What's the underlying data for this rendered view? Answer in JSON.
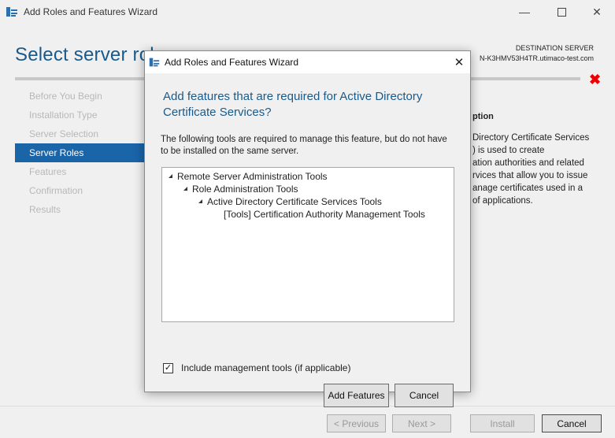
{
  "window": {
    "title": "Add Roles and Features Wizard",
    "minimize_icon": "minimize-icon",
    "maximize_icon": "maximize-icon",
    "close_icon": "close-icon"
  },
  "header": {
    "page_title": "Select server role",
    "destination_label": "DESTINATION SERVER",
    "destination_server": "N-K3HMV53H4TR.utimaco-test.com",
    "error_icon": "red-x-icon"
  },
  "nav": {
    "items": [
      {
        "label": "Before You Begin",
        "active": false
      },
      {
        "label": "Installation Type",
        "active": false
      },
      {
        "label": "Server Selection",
        "active": false
      },
      {
        "label": "Server Roles",
        "active": true
      },
      {
        "label": "Features",
        "active": false
      },
      {
        "label": "Confirmation",
        "active": false
      },
      {
        "label": "Results",
        "active": false
      }
    ]
  },
  "description": {
    "heading": "ption",
    "lines": [
      "Directory Certificate Services",
      ") is used to create",
      "ation authorities and related",
      "rvices that allow you to issue",
      "anage certificates used in a",
      " of applications."
    ]
  },
  "footer": {
    "previous_label": "< Previous",
    "next_label": "Next >",
    "install_label": "Install",
    "cancel_label": "Cancel"
  },
  "dialog": {
    "title": "Add Roles and Features Wizard",
    "heading": "Add features that are required for Active Directory Certificate Services?",
    "info": "The following tools are required to manage this feature, but do not have to be installed on the same server.",
    "tree": [
      {
        "label": "Remote Server Administration Tools",
        "level": 0,
        "expanded": true
      },
      {
        "label": "Role Administration Tools",
        "level": 1,
        "expanded": true
      },
      {
        "label": "Active Directory Certificate Services Tools",
        "level": 2,
        "expanded": true
      },
      {
        "label": "[Tools] Certification Authority Management Tools",
        "level": 3,
        "expanded": false
      }
    ],
    "include_tools_label": "Include management tools (if applicable)",
    "include_tools_checked": true,
    "add_features_label": "Add Features",
    "cancel_label": "Cancel"
  },
  "colors": {
    "accent": "#1a64a8",
    "title_blue": "#1a5a8a",
    "error_red": "#e00000"
  }
}
